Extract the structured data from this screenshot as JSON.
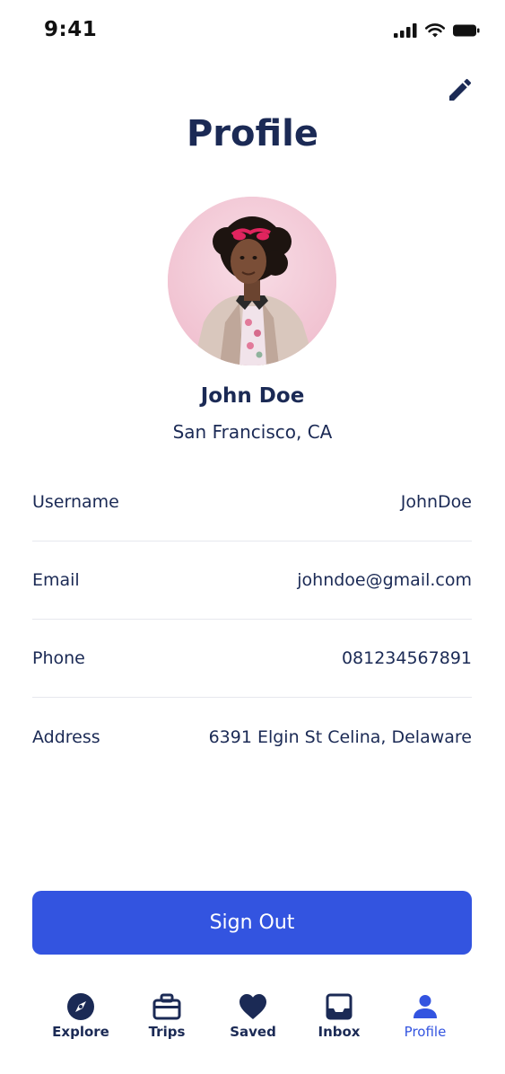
{
  "status_bar": {
    "time": "9:41"
  },
  "header": {
    "title": "Profile"
  },
  "user": {
    "name": "John Doe",
    "location": "San Francisco, CA"
  },
  "details": [
    {
      "label": "Username",
      "value": "JohnDoe"
    },
    {
      "label": "Email",
      "value": "johndoe@gmail.com"
    },
    {
      "label": "Phone",
      "value": "081234567891"
    },
    {
      "label": "Address",
      "value": "6391 Elgin St Celina, Delaware"
    }
  ],
  "actions": {
    "sign_out": "Sign Out"
  },
  "tab_bar": {
    "tabs": [
      {
        "label": "Explore",
        "icon": "compass-icon",
        "active": false
      },
      {
        "label": "Trips",
        "icon": "briefcase-icon",
        "active": false
      },
      {
        "label": "Saved",
        "icon": "heart-icon",
        "active": false
      },
      {
        "label": "Inbox",
        "icon": "inbox-icon",
        "active": false
      },
      {
        "label": "Profile",
        "icon": "person-icon",
        "active": true
      }
    ]
  },
  "colors": {
    "primary": "#3354e0",
    "text_dark": "#1b2a55",
    "divider": "#e6e8ee",
    "avatar_bg": "#f3c9d5"
  }
}
